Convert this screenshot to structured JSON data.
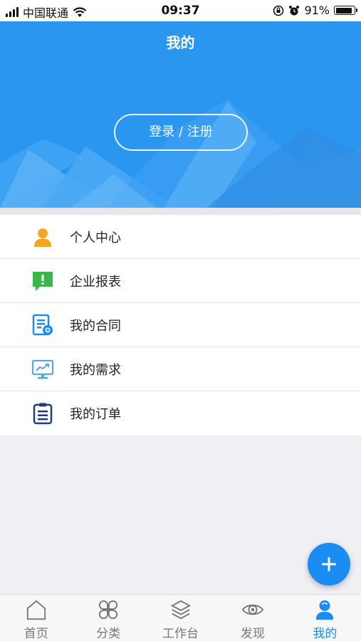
{
  "status_bar": {
    "carrier": "中国联通",
    "time": "09:37",
    "battery": "91%",
    "battery_level": 0.91
  },
  "header": {
    "title": "我的",
    "login_label": "登录 / 注册",
    "background_color": "#2b96f0"
  },
  "menu": {
    "items": [
      {
        "label": "个人中心",
        "icon": "person-icon",
        "color": "#f5a623"
      },
      {
        "label": "企业报表",
        "icon": "report-message-icon",
        "color": "#3cb54a"
      },
      {
        "label": "我的合同",
        "icon": "contract-icon",
        "color": "#1a8cf2"
      },
      {
        "label": "我的需求",
        "icon": "monitor-chart-icon",
        "color": "#5aa7e0"
      },
      {
        "label": "我的订单",
        "icon": "clipboard-icon",
        "color": "#1f3b7a"
      }
    ]
  },
  "fab": {
    "icon": "plus-icon"
  },
  "tabbar": {
    "tabs": [
      {
        "label": "首页",
        "icon": "home-icon",
        "active": false
      },
      {
        "label": "分类",
        "icon": "category-icon",
        "active": false
      },
      {
        "label": "工作台",
        "icon": "layers-icon",
        "active": false
      },
      {
        "label": "发现",
        "icon": "eye-icon",
        "active": false
      },
      {
        "label": "我的",
        "icon": "user-icon",
        "active": true
      }
    ],
    "active_color": "#1a8cf2"
  }
}
